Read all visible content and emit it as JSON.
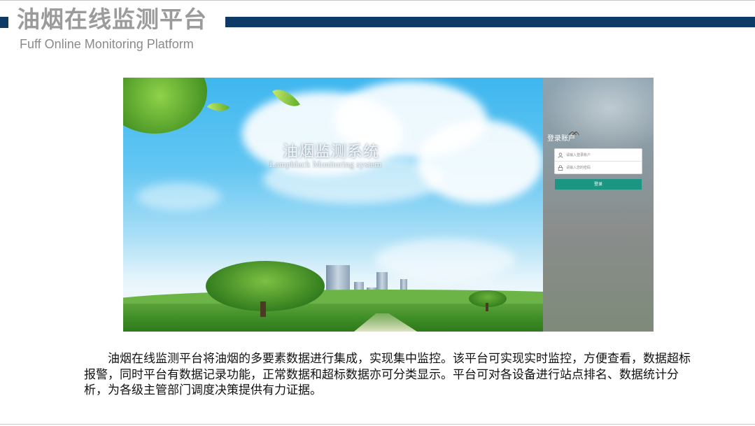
{
  "header": {
    "title": "油烟在线监测平台",
    "subtitle": "Fuff Online Monitoring Platform",
    "accent_color": "#0d3b66"
  },
  "screenshot": {
    "system_title": "油烟监测系统",
    "system_subtitle": "Lampblack Monitoring system",
    "login": {
      "title": "登录账户",
      "username_placeholder": "请输入登录账户",
      "password_placeholder": "请输入您的密码",
      "username_icon": "user-icon",
      "password_icon": "lock-icon",
      "button_label": "登录",
      "button_color": "#1a9682"
    }
  },
  "description": "油烟在线监测平台将油烟的多要素数据进行集成，实现集中监控。该平台可实现实时监控，方便查看，数据超标报警，同时平台有数据记录功能，正常数据和超标数据亦可分类显示。平台可对各设备进行站点排名、数据统计分析，为各级主管部门调度决策提供有力证据。"
}
